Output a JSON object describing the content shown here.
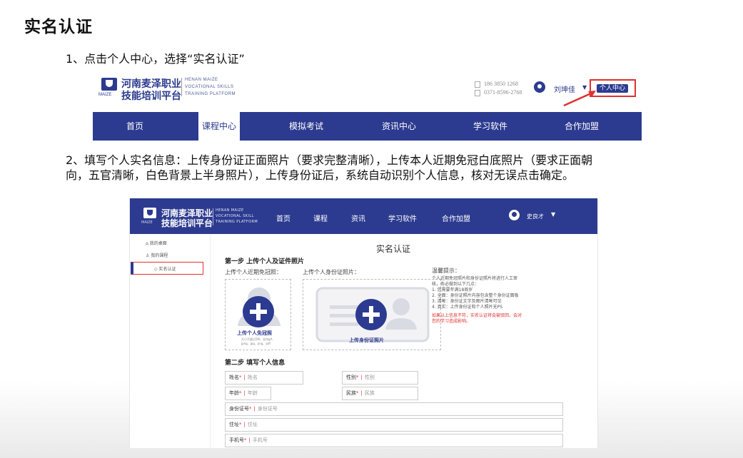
{
  "page_title": "实名认证",
  "step1_text": "1、点击个人中心，选择“实名认证”",
  "step2_line1": "2、填写个人实名信息：上传身份证正面照片（要求完整清晰），上传本人近期免冠白底照片（要求正面朝",
  "step2_line2": "向，五官清晰，白色背景上半身照片），上传身份证后，系统自动识别个人信息，核对无误点击确定。",
  "shot1": {
    "brand_name_1": "河南麦泽职业",
    "brand_name_2": "技能培训平台",
    "brand_logo_text": "MAIZE",
    "brand_en": [
      "HENAN MAIZE",
      "VOCATIONAL SKILLS",
      "TRAINING PLATFORM"
    ],
    "phone1": "186 3850 1268",
    "phone2": "0371-8596-2768",
    "user_name": "刘坤佳",
    "personal_center": "个人中心",
    "nav": [
      {
        "label": "首页",
        "active": false
      },
      {
        "label": "课程中心",
        "active": true
      },
      {
        "label": "模拟考试",
        "active": false
      },
      {
        "label": "资讯中心",
        "active": false
      },
      {
        "label": "学习软件",
        "active": false
      },
      {
        "label": "合作加盟",
        "active": false
      }
    ],
    "accent_color": "#2c3b8f",
    "highlight_color": "#e03030"
  },
  "shot2": {
    "brand_name_1": "河南麦泽职业",
    "brand_name_2": "技能培训平台",
    "brand_logo_text": "MAIZE",
    "brand_en": [
      "HENAN MAIZE",
      "VOCATIONAL SKILL",
      "TRAINING PLATFORM"
    ],
    "nav": [
      "首页",
      "课程",
      "资讯",
      "学习软件",
      "合作加盟"
    ],
    "user_name": "史良才",
    "sidebar": [
      "我的桌面",
      "我的课程",
      "实名认证"
    ],
    "content_title": "实名认证",
    "step1_title": "第一步 上传个人及证件照片",
    "label_photo": "上传个人近期免冠照：",
    "label_id": "上传个人身份证照片：",
    "upload_photo_caption": "上传个人免冠照",
    "upload_photo_hint1": "大小不超过5M，支持gif、",
    "upload_photo_hint2": "jpeg、jpg、png、pdf",
    "upload_id_caption": "上传身份证照片",
    "tips_title": "温馨提示：",
    "tips": [
      "个人近期免冠照片和身份证照片将进行人工审",
      "核，务必做到以下几点：",
      "1. 您需要年满18周岁",
      "2. 全面：身份证照片内容包含整个身份证面板",
      "3. 清晰：身份证文字及图片清晰可见",
      "4. 真实：上传身份证和个人照片无PS"
    ],
    "tips_warning": [
      "如果以上信息不符，实名认证将会被驳回，会对",
      "您的学习造成影响。"
    ],
    "step2_title": "第二步 填写个人信息",
    "fields": {
      "name": {
        "label": "姓名",
        "placeholder": "姓名"
      },
      "gender": {
        "label": "性别",
        "placeholder": "性别"
      },
      "age": {
        "label": "年龄",
        "placeholder": "年龄"
      },
      "ethnic": {
        "label": "民族",
        "placeholder": "民族"
      },
      "idno": {
        "label": "身份证号",
        "placeholder": "身份证号"
      },
      "address": {
        "label": "住址",
        "placeholder": "住址"
      },
      "phone": {
        "label": "手机号",
        "placeholder": "手机号"
      }
    },
    "required_mark": "*",
    "field_separator": "|"
  }
}
